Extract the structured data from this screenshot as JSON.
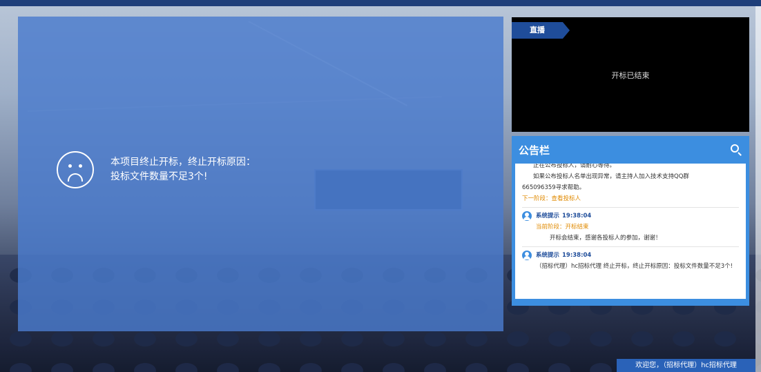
{
  "live": {
    "tag_label": "直播",
    "status": "开标已结束"
  },
  "termination": {
    "line1": "本项目终止开标，终止开标原因：",
    "line2": "投标文件数量不足3个!"
  },
  "notice": {
    "title": "公告栏",
    "first_block": {
      "line_cut": "正在公布投标人，请耐心等待。",
      "line1": "如果公布投标人名单出现异常，请主持人加入技术支持QQ群",
      "line2": "665096359寻求帮助。",
      "next_phase": "下一阶段：查看投标人"
    },
    "messages": [
      {
        "sender": "系统提示",
        "time": "19:38:04",
        "phase": "当前阶段：开标结束",
        "text": "开标会结束，感谢各投标人的参加，谢谢！"
      },
      {
        "sender": "系统提示",
        "time": "19:38:04",
        "phase": "",
        "text": "（招标代理）hc招标代理 终止开标，终止开标原因：投标文件数量不足3个!"
      }
    ]
  },
  "footer": {
    "welcome": "欢迎您，（招标代理）hc招标代理"
  },
  "colors": {
    "overlay": "#4a7bcd",
    "notice_header": "#3c8ee0",
    "accent_orange": "#e08a00",
    "sender_blue": "#1f4d9a"
  }
}
